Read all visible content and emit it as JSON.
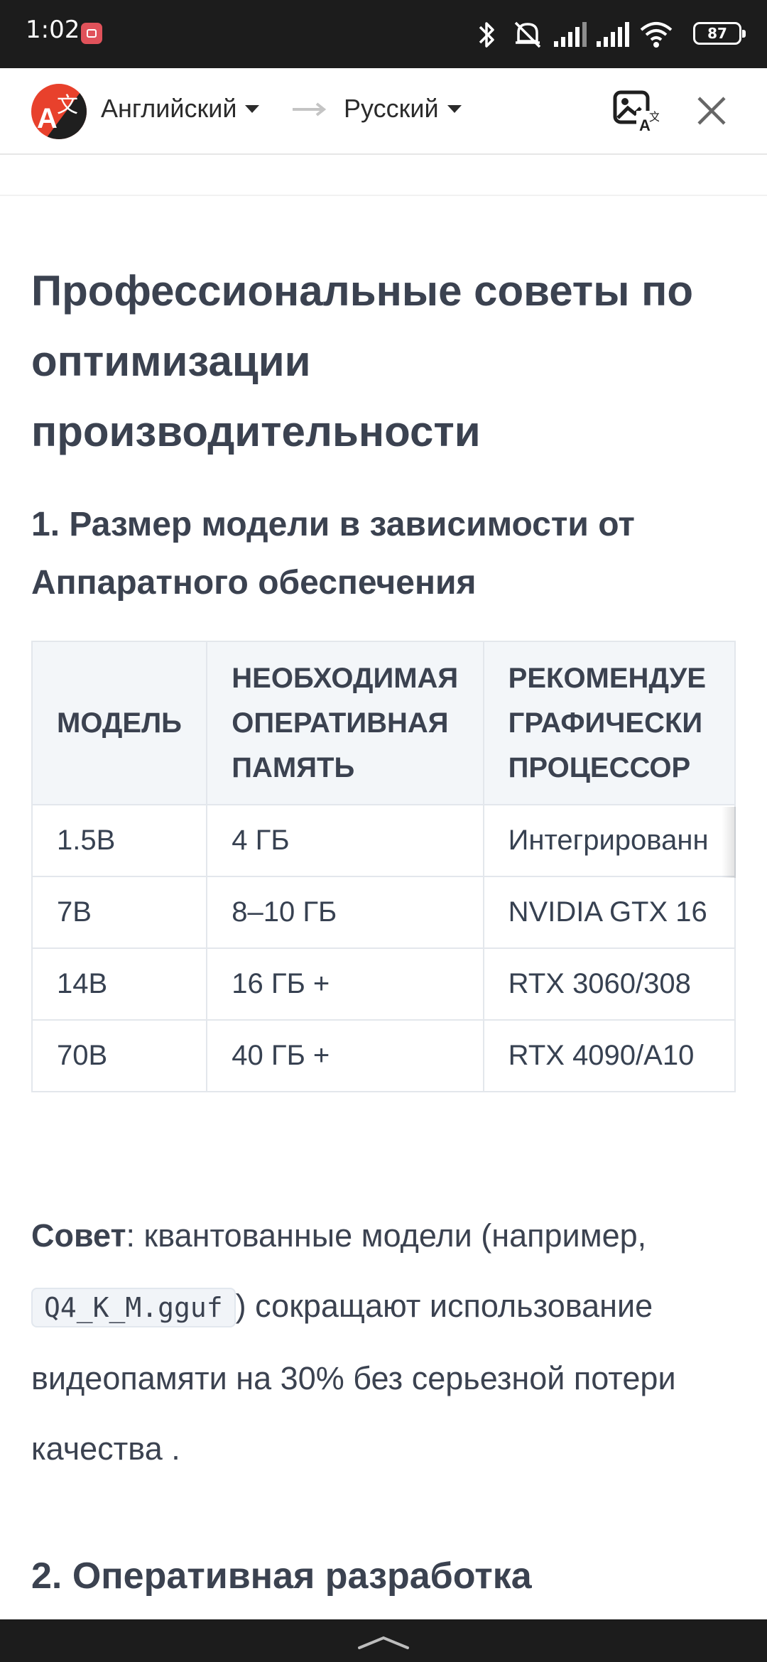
{
  "status_bar": {
    "time": "1:02",
    "battery": "87",
    "icons": [
      "bluetooth-icon",
      "mute-icon",
      "signal-icon",
      "signal-icon",
      "wifi-icon",
      "battery-icon"
    ]
  },
  "toolbar": {
    "source_lang": "Английский",
    "target_lang": "Русский"
  },
  "article": {
    "heading": "Профессиональные советы по оптимизации производительности",
    "subheading": "1. Размер модели в зависимости от Аппаратного обеспечения",
    "table": {
      "headers": [
        "МОДЕЛЬ",
        "НЕОБХОДИМАЯ ОПЕРАТИВНАЯ ПАМЯТЬ",
        "РЕКОМЕНДУЕМЫЙ ГРАФИЧЕСКИЙ ПРОЦЕССОР"
      ],
      "header_lines": [
        [
          "МОДЕЛЬ"
        ],
        [
          "НЕОБХОДИМАЯ",
          "ОПЕРАТИВНАЯ",
          "ПАМЯТЬ"
        ],
        [
          "РЕКОМЕНДУЕ",
          "ГРАФИЧЕСКИ",
          "ПРОЦЕССОР"
        ]
      ],
      "rows": [
        [
          "1.5B",
          "4 ГБ",
          "Интегрированн"
        ],
        [
          "7B",
          "8–10 ГБ",
          "NVIDIA GTX 16"
        ],
        [
          "14B",
          "16 ГБ +",
          "RTX 3060/308"
        ],
        [
          "70B",
          "40 ГБ +",
          "RTX 4090/A10"
        ]
      ]
    },
    "tip": {
      "label": "Совет",
      "text_before": ": квантованные модели (например, ",
      "code": "Q4_K_M.gguf",
      "text_after": ") сокращают использование видеопамяти на 30% без серьезной потери качества ."
    },
    "next_heading": "2. Оперативная разработка"
  },
  "colors": {
    "status_bar_bg": "#1c1c1c",
    "heading_text": "#3b4250",
    "table_header_bg": "#f3f6f9",
    "logo_red": "#e8412c"
  }
}
